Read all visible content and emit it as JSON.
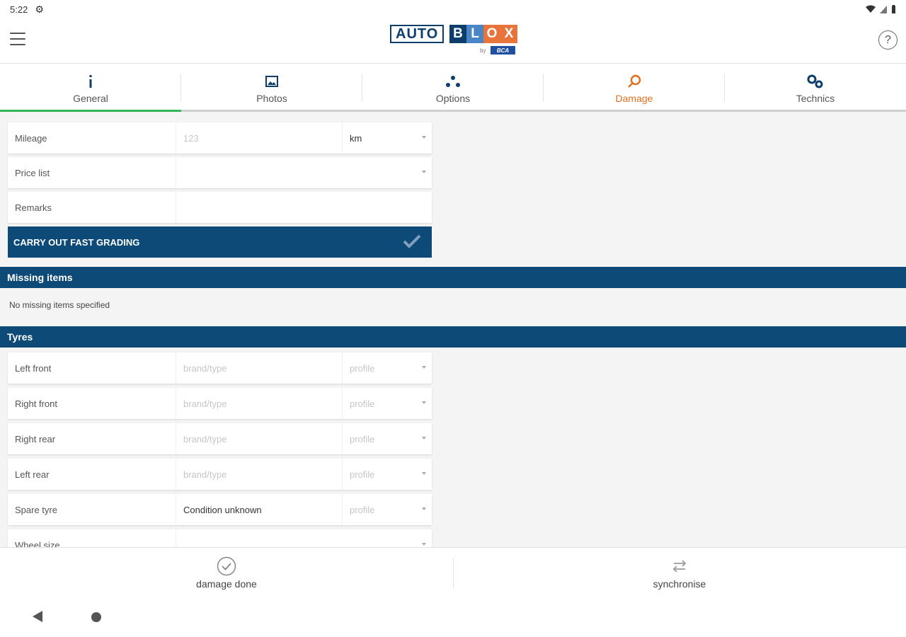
{
  "status_bar": {
    "time": "5:22",
    "settings_icon": "gear-icon",
    "right_icons": [
      "wifi-icon",
      "signal-icon",
      "battery-icon"
    ]
  },
  "header": {
    "logo": {
      "auto": "AUTO",
      "blox": [
        "B",
        "L",
        "O",
        "X"
      ],
      "blox_colors": [
        "#0d3d6b",
        "#4a86c6",
        "#e8743b",
        "#e8743b"
      ],
      "by": "by",
      "bca": "BCA"
    },
    "menu_icon": "hamburger-icon",
    "help_icon": "help-icon"
  },
  "tabs": [
    {
      "label": "General",
      "icon": "info-icon"
    },
    {
      "label": "Photos",
      "icon": "image-icon"
    },
    {
      "label": "Options",
      "icon": "options-icon"
    },
    {
      "label": "Damage",
      "icon": "magnifier-icon"
    },
    {
      "label": "Technics",
      "icon": "gears-icon"
    }
  ],
  "form": {
    "mileage": {
      "label": "Mileage",
      "placeholder": "123",
      "unit": "km"
    },
    "price_list": {
      "label": "Price list"
    },
    "remarks": {
      "label": "Remarks"
    },
    "fast_grading_button": "CARRY OUT FAST GRADING"
  },
  "missing_items": {
    "title": "Missing items",
    "empty_text": "No missing items specified"
  },
  "tyres": {
    "title": "Tyres",
    "rows": [
      {
        "label": "Left front",
        "value": "brand/type",
        "value_placeholder": true,
        "profile": "profile"
      },
      {
        "label": "Right front",
        "value": "brand/type",
        "value_placeholder": true,
        "profile": "profile"
      },
      {
        "label": "Right rear",
        "value": "brand/type",
        "value_placeholder": true,
        "profile": "profile"
      },
      {
        "label": "Left rear",
        "value": "brand/type",
        "value_placeholder": true,
        "profile": "profile"
      },
      {
        "label": "Spare tyre",
        "value": "Condition unknown",
        "value_placeholder": false,
        "profile": "profile"
      }
    ],
    "wheel_size": {
      "label": "Wheel size"
    }
  },
  "actions": {
    "damage_done": "damage done",
    "synchronise": "synchronise"
  },
  "colors": {
    "primary": "#0d4a78",
    "accent": "#e07020",
    "active_green": "#33b55a"
  }
}
